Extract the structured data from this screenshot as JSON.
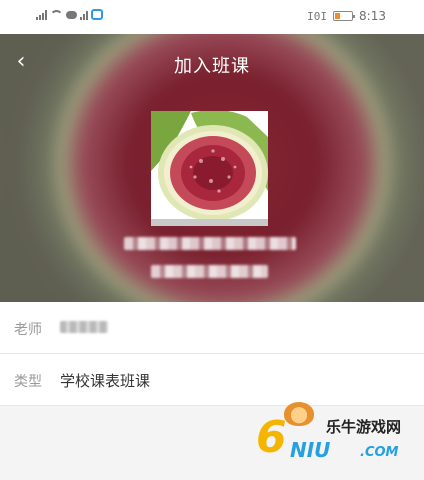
{
  "status_bar": {
    "left_icons": [
      "signal-icon",
      "wifi-icon",
      "chat-icon",
      "signal-small-icon",
      "app-icon"
    ],
    "vibrate_glyph": "I0I",
    "time": "8:13"
  },
  "header": {
    "back_glyph": "‹",
    "title": "加入班课"
  },
  "course": {
    "cover_icon": "fig-fruit-image"
  },
  "rows": {
    "teacher_label": "老师",
    "type_label": "类型",
    "type_value": "学校课表班课"
  },
  "watermark": {
    "digit": "6",
    "cn": "乐牛游戏网",
    "en": "NIU",
    "domain": ".COM"
  },
  "colors": {
    "accent_blue": "#25a0e0",
    "watermark_gold": "#f5b400",
    "battery": "#f28b2a"
  }
}
